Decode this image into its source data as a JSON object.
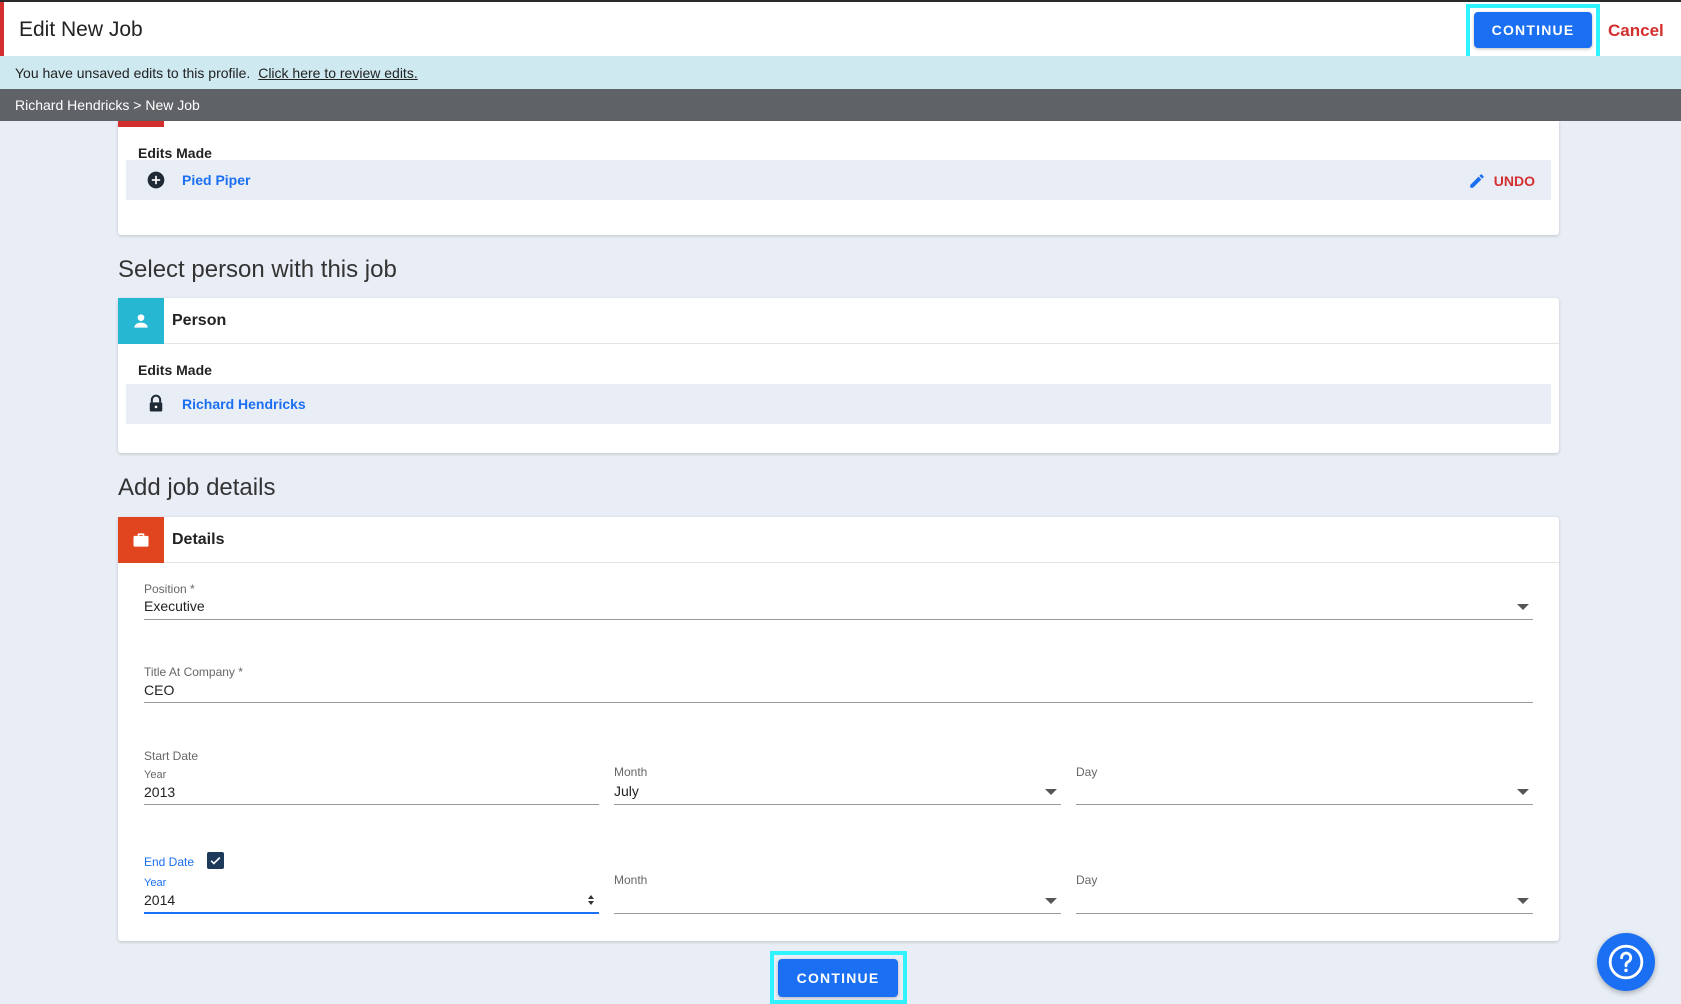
{
  "header": {
    "title": "Edit New Job",
    "continue_label": "CONTINUE",
    "cancel_label": "Cancel"
  },
  "banner": {
    "message": "You have unsaved edits to this profile.",
    "link": "Click here to review edits."
  },
  "breadcrumb": "Richard Hendricks > New Job",
  "company_card": {
    "edits_label": "Edits Made",
    "item": "Pied Piper",
    "item_icon": "add-circle-icon",
    "undo_label": "UNDO"
  },
  "person_section": {
    "title": "Select person with this job",
    "card_label": "Person",
    "edits_label": "Edits Made",
    "item": "Richard Hendricks",
    "item_icon": "lock-icon",
    "badge_color": "#26b8d3"
  },
  "details_section": {
    "title": "Add job details",
    "card_label": "Details",
    "badge_color": "#e0451f",
    "position": {
      "label": "Position *",
      "value": "Executive"
    },
    "title_at_company": {
      "label": "Title At Company *",
      "value": "CEO"
    },
    "start_date": {
      "label": "Start Date",
      "year_label": "Year",
      "year_value": "2013",
      "month_label": "Month",
      "month_value": "July",
      "day_label": "Day",
      "day_value": ""
    },
    "end_date": {
      "label": "End Date",
      "checked": true,
      "year_label": "Year",
      "year_value": "2014",
      "month_label": "Month",
      "month_value": "",
      "day_label": "Day",
      "day_value": ""
    }
  },
  "footer": {
    "continue_label": "CONTINUE"
  },
  "colors": {
    "primary": "#1a6ff2",
    "danger": "#d32f2f",
    "highlight": "#2ff3ff"
  }
}
